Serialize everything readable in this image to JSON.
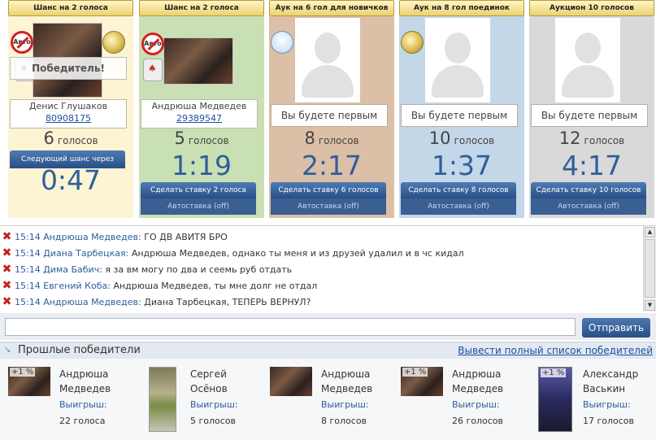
{
  "lots": [
    {
      "header": "Шанс на 2 голоса",
      "bg": "#fdf4d4",
      "badge_no_auto": "Авто",
      "winner_label": "Победитель!",
      "name": "Денис Глушаков",
      "id": "80908175",
      "votes_num": "6",
      "votes_word": "голосов",
      "next_label": "Следующий шанс через",
      "timer": "0:47"
    },
    {
      "header": "Шанс на 2 голоса",
      "bg": "#c9e0b4",
      "badge_no_auto": "Авто",
      "name": "Андрюша Медведев",
      "id": "29389547",
      "votes_num": "5",
      "votes_word": "голосов",
      "timer": "1:19",
      "bid_label": "Сделать ставку 2 голоса",
      "auto_label": "Автоставка (off)"
    },
    {
      "header": "Аук на 6 гол для новичков",
      "bg": "#dbbfa6",
      "first_label": "Вы будете первым",
      "votes_num": "8",
      "votes_word": "голосов",
      "timer": "2:17",
      "bid_label": "Сделать ставку 6 голосов",
      "auto_label": "Автоставка (off)"
    },
    {
      "header": "Аук на 8 гол поединок",
      "bg": "#c3d7e8",
      "first_label": "Вы будете первым",
      "votes_num": "10",
      "votes_word": "голосов",
      "timer": "1:37",
      "bid_label": "Сделать ставку 8 голосов",
      "auto_label": "Автоставка (off)"
    },
    {
      "header": "Аукцион 10 голосов",
      "bg": "#d9d9d9",
      "first_label": "Вы будете первым",
      "votes_num": "12",
      "votes_word": "голосов",
      "timer": "4:17",
      "bid_label": "Сделать ставку 10 голосов",
      "auto_label": "Автоставка (off)"
    }
  ],
  "chat": [
    {
      "meta": "15:14 Андрюша Медведев:",
      "text": "ГО ДВ АВИТЯ БРО"
    },
    {
      "meta": "15:14 Диана Тарбецкая:",
      "text": "Андрюша Медведев, однако ты меня и из друзей удалил и в чс кидал"
    },
    {
      "meta": "15:14 Дима Бабич:",
      "text": "я за вм могу по два и сеемь руб отдать"
    },
    {
      "meta": "15:14 Евгений Коба:",
      "text": "Андрюша Медведев, ты мне долг не отдал"
    },
    {
      "meta": "15:14 Андрюша Медведев:",
      "text": "Диана Тарбецкая, ТЕПЕРЬ ВЕРНУЛ?"
    }
  ],
  "input": {
    "value": "",
    "placeholder": ""
  },
  "send_label": "Отправить",
  "past": {
    "title": "Прошлые победители",
    "full_list_label": "Вывести полный список победителей",
    "win_label": "Выигрыш:",
    "winners": [
      {
        "name1": "Андрюша",
        "name2": "Медведев",
        "pct": "+1 %",
        "prize": "22 голоса",
        "photo": "dark"
      },
      {
        "name1": "Сергей",
        "name2": "Осёнов",
        "pct": "",
        "prize": "5 голосов",
        "photo": "tall"
      },
      {
        "name1": "Андрюша",
        "name2": "Медведев",
        "pct": "",
        "prize": "8 голосов",
        "photo": "dark"
      },
      {
        "name1": "Андрюша",
        "name2": "Медведев",
        "pct": "+1 %",
        "prize": "26 голосов",
        "photo": "dark"
      },
      {
        "name1": "Александр",
        "name2": "Васькин",
        "pct": "+1 %",
        "prize": "17 голосов",
        "photo": "blue"
      }
    ]
  }
}
